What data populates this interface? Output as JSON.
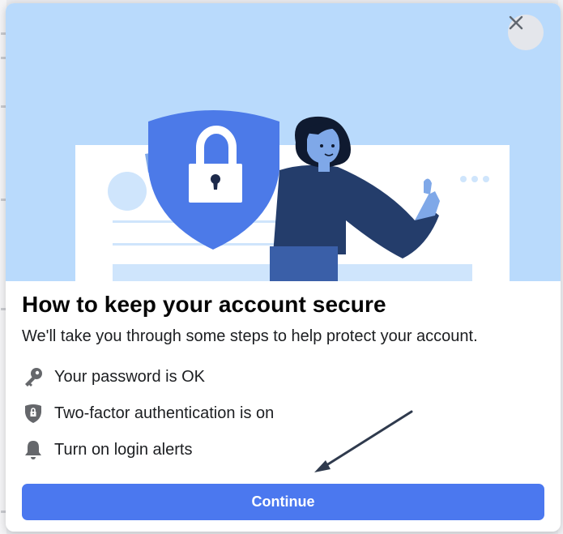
{
  "dialog": {
    "title": "How to keep your account secure",
    "subtitle": "We'll take you through some steps to help protect your account.",
    "steps": [
      {
        "icon": "key-icon",
        "label": "Your password is OK"
      },
      {
        "icon": "shield-lock-icon",
        "label": "Two-factor authentication is on"
      },
      {
        "icon": "bell-icon",
        "label": "Turn on login alerts"
      }
    ],
    "continue_label": "Continue",
    "close_icon": "close-icon"
  },
  "colors": {
    "hero_bg": "#b9dafc",
    "primary": "#4b78ef",
    "shield": "#4c7ae8",
    "text": "#1c1e21",
    "icon_gray": "#65676b",
    "annotation_arrow": "#2f3a4d"
  }
}
